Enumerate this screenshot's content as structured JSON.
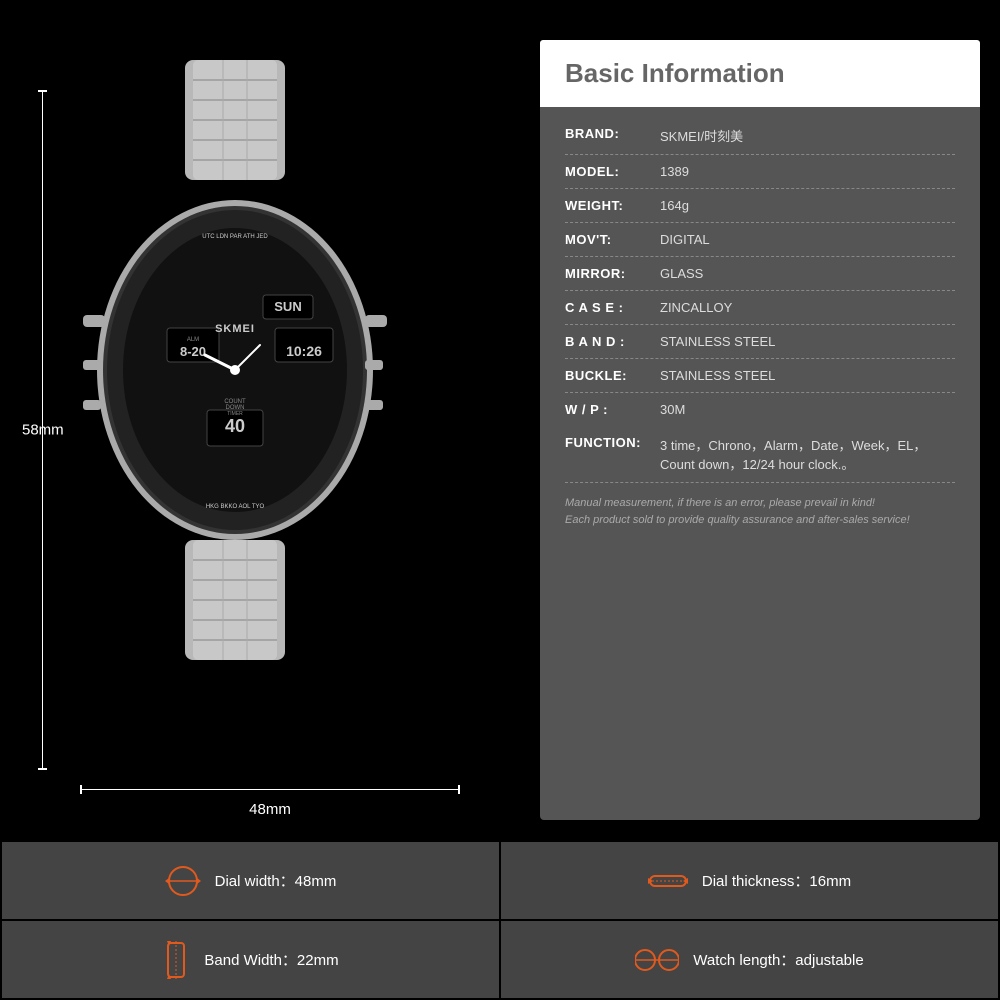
{
  "info": {
    "title": "Basic Information",
    "rows": [
      {
        "label": "BRAND:",
        "value": "SKMEI/时刻美"
      },
      {
        "label": "MODEL:",
        "value": "1389"
      },
      {
        "label": "WEIGHT:",
        "value": "164g"
      },
      {
        "label": "MOV'T:",
        "value": "DIGITAL"
      },
      {
        "label": "MIRROR:",
        "value": "GLASS"
      },
      {
        "label": "C A S E :",
        "value": "ZINCALLOY"
      },
      {
        "label": "B A N D :",
        "value": "STAINLESS STEEL"
      },
      {
        "label": "BUCKLE:",
        "value": "STAINLESS STEEL"
      },
      {
        "label": "W / P :",
        "value": "30M"
      }
    ],
    "function_label": "FUNCTION:",
    "function_value": "3 time，Chrono，Alarm，Date，Week，EL，Count down，12/24 hour clock.。",
    "note": "Manual measurement, if there is an error, please prevail in kind!\nEach product sold to provide quality assurance and after-sales service!"
  },
  "dimensions": {
    "height": "58mm",
    "width": "48mm"
  },
  "specs": [
    {
      "icon": "dial-width",
      "label": "Dial width：",
      "value": "48mm"
    },
    {
      "icon": "dial-thickness",
      "label": "Dial thickness：",
      "value": "16mm"
    },
    {
      "icon": "band-width",
      "label": "Band Width：",
      "value": "22mm"
    },
    {
      "icon": "watch-length",
      "label": "Watch length：",
      "value": "adjustable"
    }
  ]
}
